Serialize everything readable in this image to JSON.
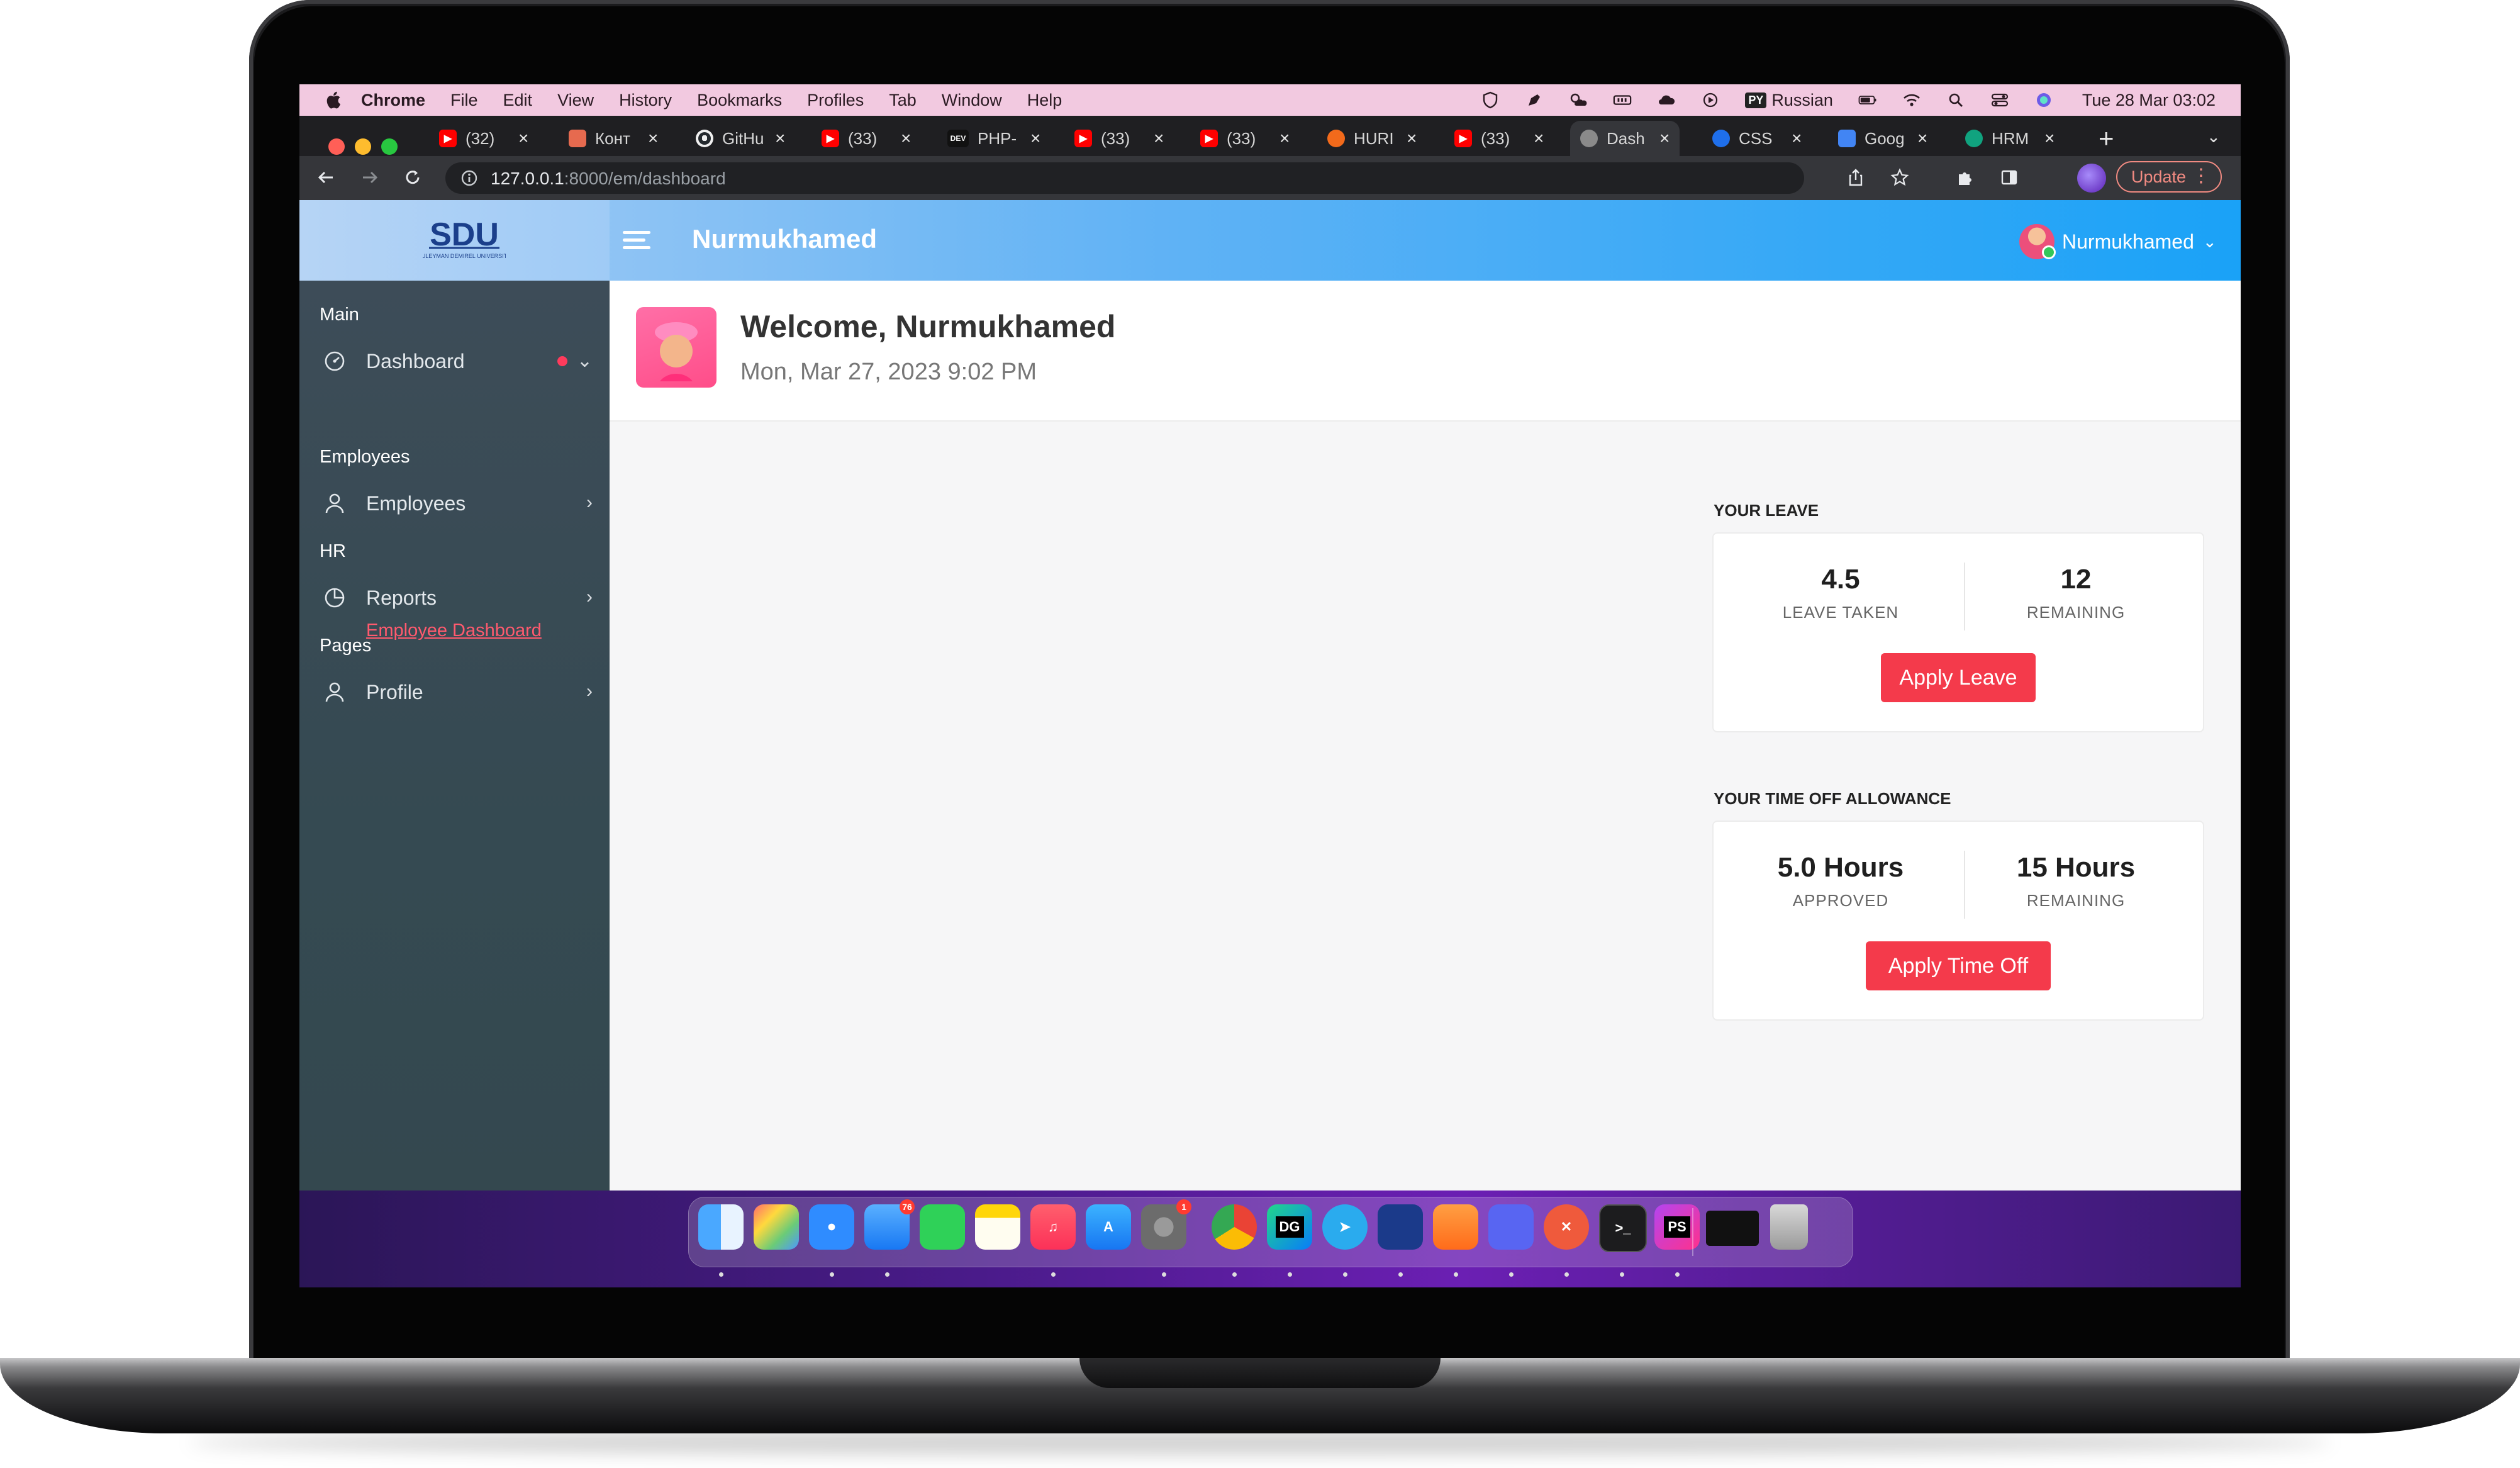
{
  "menubar": {
    "app_name": "Chrome",
    "menus": [
      "File",
      "Edit",
      "View",
      "History",
      "Bookmarks",
      "Profiles",
      "Tab",
      "Window",
      "Help"
    ],
    "input_source": "Russian",
    "input_badge": "PY",
    "clock": "Tue 28 Mar  03:02"
  },
  "browser": {
    "tabs": [
      {
        "title": "(32)",
        "icon": "youtube-icon",
        "color": "#ff0000"
      },
      {
        "title": "Конт",
        "icon": "page-icon",
        "color": "#e66a4f"
      },
      {
        "title": "GitHu",
        "icon": "github-icon",
        "color": "#24292e"
      },
      {
        "title": "(33)",
        "icon": "youtube-icon",
        "color": "#ff0000"
      },
      {
        "title": "PHP-",
        "icon": "dev-icon",
        "color": "#111111"
      },
      {
        "title": "(33)",
        "icon": "youtube-icon",
        "color": "#ff0000"
      },
      {
        "title": "(33)",
        "icon": "youtube-icon",
        "color": "#ff0000"
      },
      {
        "title": "HURI",
        "icon": "hurl-icon",
        "color": "#f26a1b"
      },
      {
        "title": "(33)",
        "icon": "youtube-icon",
        "color": "#ff0000"
      },
      {
        "title": "Dash",
        "icon": "globe-icon",
        "color": "#8a8a8a"
      },
      {
        "title": "CSS",
        "icon": "css-icon",
        "color": "#1f6feb"
      },
      {
        "title": "Goog",
        "icon": "google-docs-icon",
        "color": "#4285f4"
      },
      {
        "title": "HRM",
        "icon": "chatgpt-icon",
        "color": "#10a37f"
      }
    ],
    "dev_label": "DEV",
    "new_tab": "+",
    "close_glyph": "×",
    "url_host": "127.0.0.1",
    "url_rest": ":8000/em/dashboard",
    "update_label": "Update"
  },
  "app": {
    "brand": "Nurmukhamed",
    "logo_text": "SDU",
    "logo_sub": "SULEYMAN DEMIREL UNIVERSITY",
    "user_name": "Nurmukhamed"
  },
  "sidebar": {
    "sections": {
      "main": "Main",
      "employees": "Employees",
      "hr": "HR",
      "pages": "Pages"
    },
    "items": {
      "dashboard": "Dashboard",
      "employee_dashboard": "Employee Dashboard",
      "employees": "Employees",
      "reports": "Reports",
      "profile": "Profile"
    }
  },
  "welcome": {
    "title": "Welcome, Nurmukhamed",
    "date": "Mon, Mar 27, 2023 9:02 PM"
  },
  "leave": {
    "section_title": "YOUR LEAVE",
    "taken_value": "4.5",
    "taken_label": "LEAVE TAKEN",
    "remaining_value": "12",
    "remaining_label": "REMAINING",
    "button": "Apply Leave"
  },
  "time_off": {
    "section_title": "YOUR TIME OFF ALLOWANCE",
    "approved_value": "5.0 Hours",
    "approved_label": "APPROVED",
    "remaining_value": "15 Hours",
    "remaining_label": "REMAINING",
    "button": "Apply Time Off"
  },
  "dock": {
    "mail_badge": "76",
    "settings_badge": "1",
    "datagrip_label": "DG",
    "phpstorm_label": "PS",
    "apps": [
      "finder-icon",
      "launchpad-icon",
      "safari-icon",
      "mail-icon",
      "facetime-icon",
      "notes-icon",
      "music-icon",
      "app-store-icon",
      "system-settings-icon",
      "chrome-icon",
      "datagrip-icon",
      "telegram-icon",
      "adguard-icon",
      "pencil-app-icon",
      "discord-icon",
      "xmind-icon",
      "terminal-icon",
      "phpstorm-icon",
      "window-preview-icon",
      "trash-icon"
    ]
  }
}
